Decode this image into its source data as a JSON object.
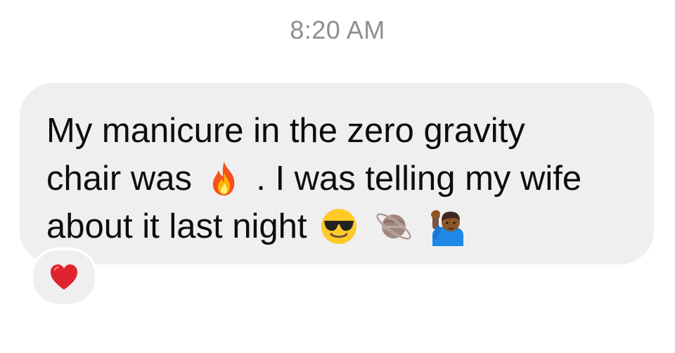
{
  "timestamp": "8:20 AM",
  "message": {
    "line1": "My manicure in the zero gravity",
    "line2_before": "chair was",
    "line2_after": ". I was telling my wife",
    "line3": "about it last night",
    "emojis": {
      "fire": "fire-icon",
      "sunglasses": "smiling-face-with-sunglasses-icon",
      "planet": "ringed-planet-icon",
      "person": "person-raising-hand-icon"
    }
  },
  "reaction": {
    "icon": "red-heart-icon",
    "color": "#e0242f"
  },
  "colors": {
    "bubble": "#efefef",
    "timestamp": "#8e8e93",
    "text": "#0d0d0d"
  }
}
